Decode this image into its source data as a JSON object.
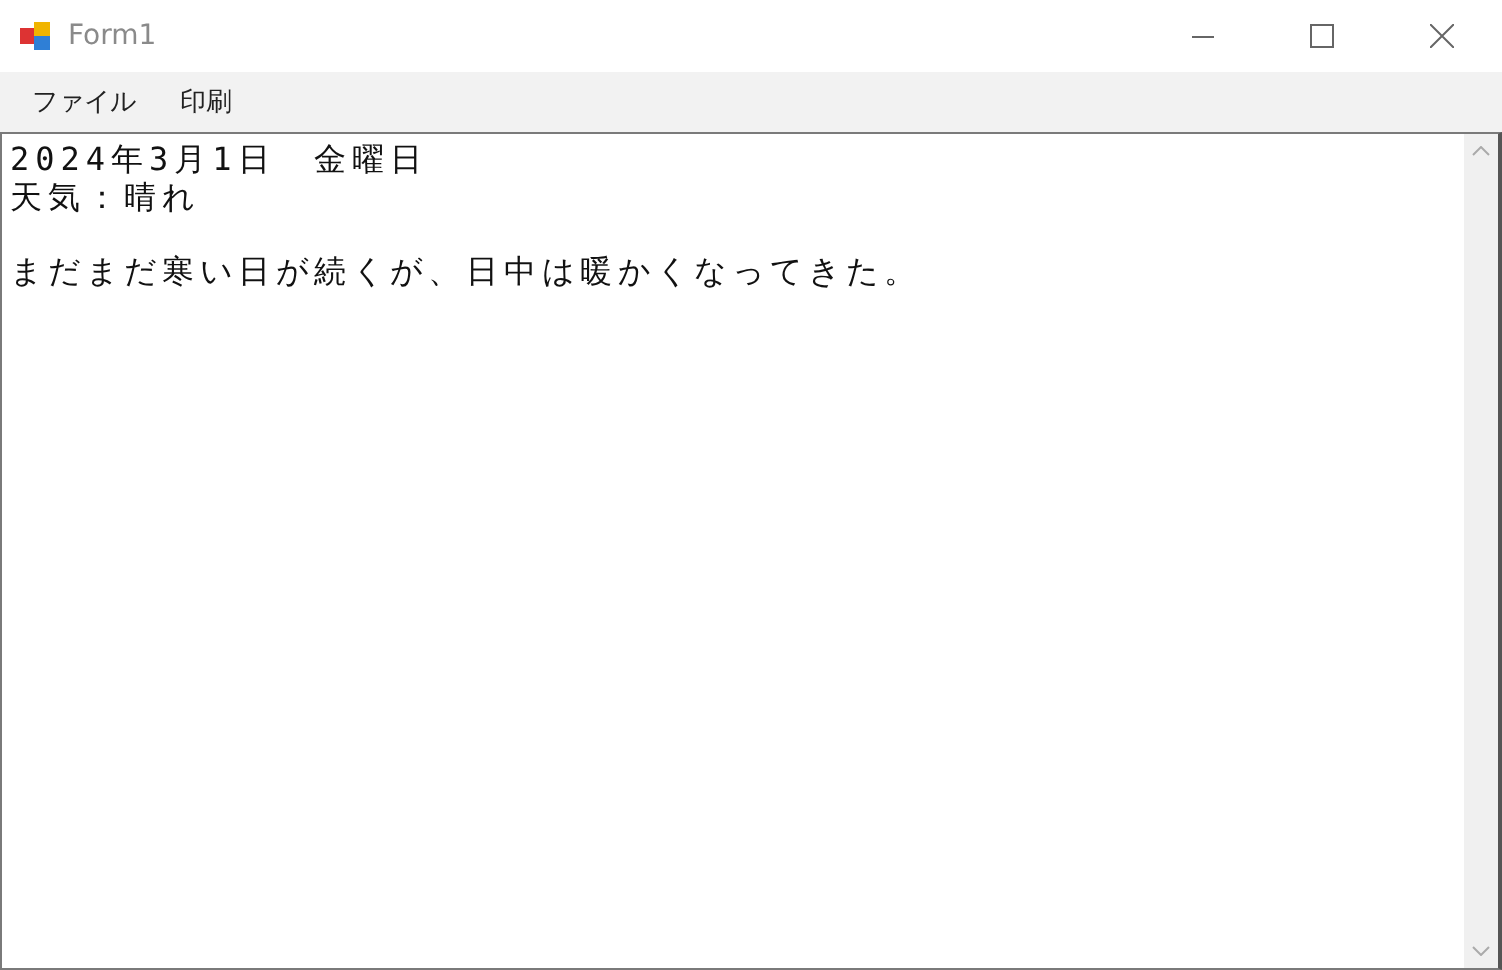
{
  "window": {
    "title": "Form1"
  },
  "menu": [
    {
      "label": "ファイル"
    },
    {
      "label": "印刷"
    }
  ],
  "editor": {
    "blocks": [
      {
        "lines": [
          "2024年3月1日　金曜日",
          "天気：晴れ"
        ]
      },
      {
        "lines": [
          "まだまだ寒い日が続くが、日中は暖かくなってきた。"
        ]
      }
    ]
  }
}
